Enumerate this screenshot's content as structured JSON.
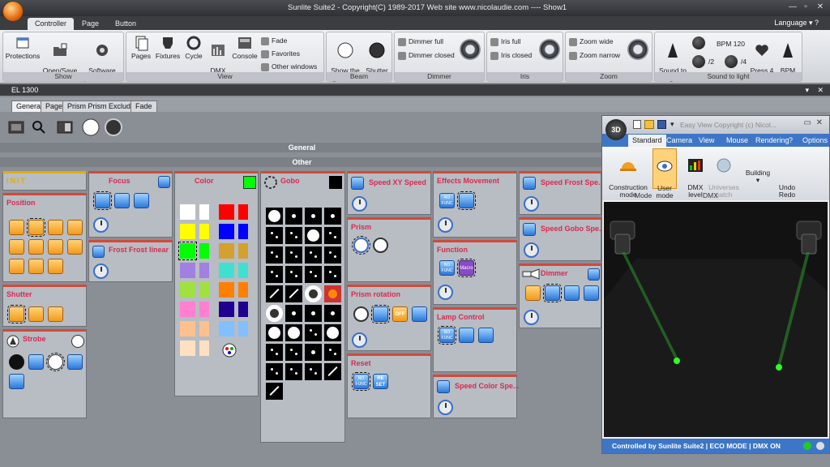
{
  "window": {
    "title": "Sunlite Suite2 - Copyright(C) 1989-2017    Web site www.nicolaudie.com ---- Show1"
  },
  "ribbon_tabs": [
    "Controller",
    "Page",
    "Button"
  ],
  "language_label": "Language",
  "ribbon": {
    "show": {
      "label": "Show",
      "protections": "Protections",
      "open_save": "Open/Save\nshow",
      "software_prefs": "Software\npreferences"
    },
    "view": {
      "label": "View",
      "pages": "Pages",
      "fixtures": "Fixtures",
      "cycle": "Cycle",
      "dmx_level": "DMX\nlevel",
      "console": "Console",
      "fade": "Fade",
      "favorites": "Favorites",
      "other_windows": "Other windows"
    },
    "beam": {
      "label": "Beam",
      "show_light": "Show the\nlight beam",
      "shutter_closed": "Shutter\nclosed"
    },
    "dimmer": {
      "label": "Dimmer",
      "full": "Dimmer full",
      "closed": "Dimmer closed"
    },
    "iris": {
      "label": "Iris",
      "full": "Iris full",
      "closed": "Iris closed"
    },
    "zoom": {
      "label": "Zoom",
      "wide": "Zoom wide",
      "narrow": "Zoom narrow"
    },
    "sound": {
      "label": "Sound to light",
      "sound_to_light": "Sound to\nlight",
      "div2": "/2",
      "bpm": "BPM 120",
      "div4": "/4",
      "press4": "Press 4\ntimes",
      "bpm_reset": "BPM\nreset"
    }
  },
  "fixture_window_title": "EL 1300",
  "sub_tabs": [
    "General",
    "Page",
    "Prism Prism Excluded",
    "Fade"
  ],
  "sections": {
    "general": "General",
    "other": "Other"
  },
  "panels": {
    "init": "INIT",
    "position": "Position",
    "shutter": "Shutter",
    "strobe": "Strobe",
    "focus": "Focus",
    "frost_linear": "Frost Frost linear",
    "color": "Color",
    "gobo": "Gobo",
    "speed_xy": "Speed XY Speed",
    "prism": "Prism",
    "prism_rotation": "Prism rotation",
    "reset": "Reset",
    "effects_movement": "Effects Movement",
    "function": "Function",
    "lamp_control": "Lamp Control",
    "speed_color": "Speed Color Spe...",
    "speed_frost": "Speed Frost Spe...",
    "speed_gobo": "Speed Gobo Spe...",
    "dimmer": "Dimmer"
  },
  "button_labels": {
    "no_func": "NO\nFUNC",
    "reset_set": "RE\nSET",
    "off": "OFF",
    "macro": "Macro"
  },
  "colors": [
    "#ffffff",
    "#ffffff",
    "#ff0000",
    "#ff0000",
    "#ffff00",
    "#ffff00",
    "#0000ff",
    "#0000ff",
    "#00ff00",
    "#00ff00",
    "#d4a030",
    "#d4a030",
    "#a080e0",
    "#a080e0",
    "#40e0d0",
    "#40e0d0",
    "#a0e040",
    "#a0e040",
    "#ff8000",
    "#ff8000",
    "#ff80d0",
    "#ff80d0",
    "#200090",
    "#200090",
    "#ffc090",
    "#ffc090",
    "#80c0ff",
    "#80c0ff",
    "#ffe0c0",
    "#ffe0c0"
  ],
  "viewer": {
    "logo": "3D",
    "title": "Easy View  Copyright (c) Nicol...",
    "tabs": [
      "Standard",
      "Camera",
      "View",
      "Mouse",
      "Rendering",
      "?",
      "Options"
    ],
    "construction_mode": "Construction\nmode",
    "user_mode": "User\nmode",
    "dmx_level": "DMX\nlevel",
    "universes_patch": "Universes\npatch",
    "building": "Building",
    "undo_redo": "Undo\nRedo",
    "group_mode": "Mode",
    "group_dmx": "DMX",
    "status": "Controlled by Sunlite Suite2  |  ECO MODE  |  DMX ON"
  }
}
